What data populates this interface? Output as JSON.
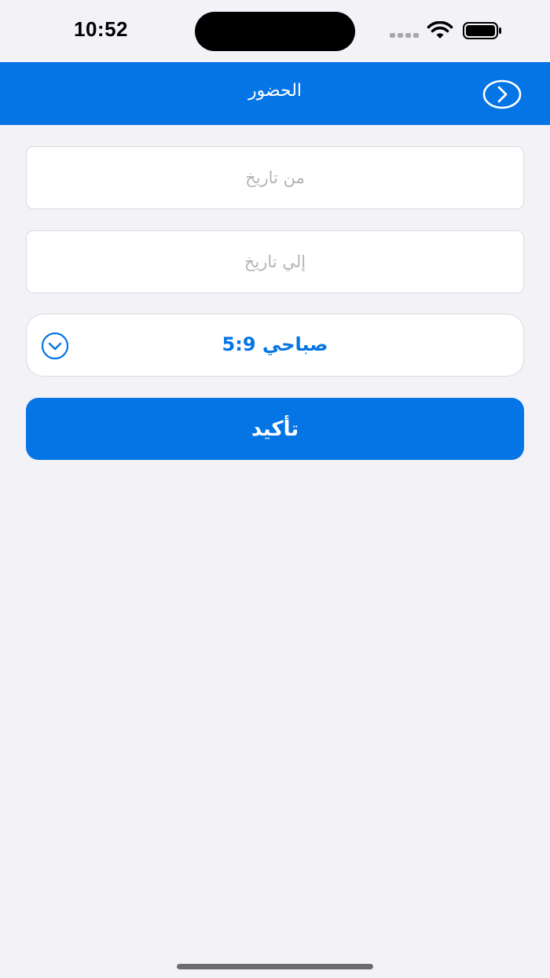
{
  "status_bar": {
    "time": "10:52"
  },
  "nav": {
    "title": "الحضور"
  },
  "form": {
    "from_date": {
      "placeholder": "من تاريخ",
      "value": ""
    },
    "to_date": {
      "placeholder": "إلي تاريخ",
      "value": ""
    },
    "shift": {
      "selected": "صباحي 5:9"
    },
    "confirm_label": "تأكيد"
  },
  "colors": {
    "primary": "#0575e6",
    "background": "#f2f2f7",
    "field_bg": "#ffffff",
    "placeholder": "#b4b4b8"
  },
  "icons": {
    "back": "chevron-right-circle-icon",
    "dropdown": "chevron-down-circle-icon"
  }
}
